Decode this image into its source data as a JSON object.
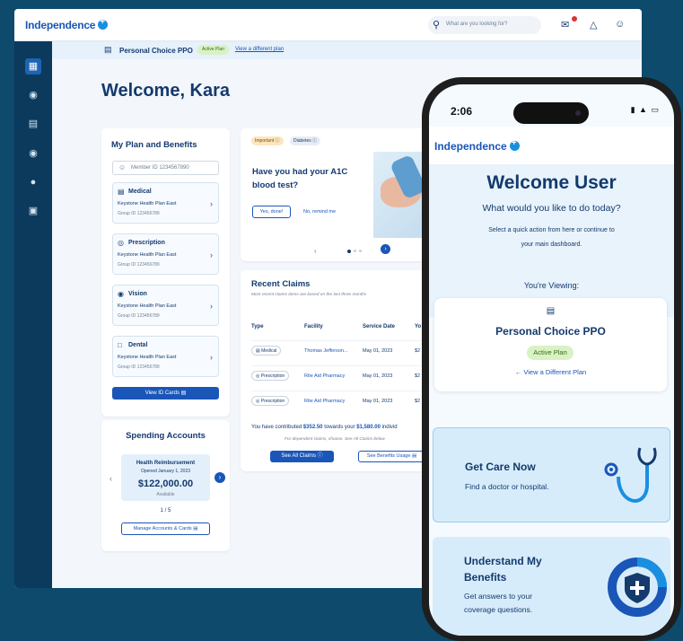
{
  "brand": {
    "name": "Independence",
    "accent": "#1a56b8",
    "navy": "#0c3a5c",
    "background": "#0d4a6b"
  },
  "desktop": {
    "search_placeholder": "What are you looking for?",
    "plan_bar": {
      "plan_name": "Personal Choice PPO",
      "status": "Active Plan",
      "link": "View a different plan"
    },
    "welcome": "Welcome, Kara",
    "plan_benefits": {
      "title": "My Plan and Benefits",
      "member_id": "Member ID 1234567890",
      "items": [
        {
          "name": "Medical",
          "plan": "Keystone Health Plan East",
          "group": "Group ID 123456789",
          "icon": "medical-icon"
        },
        {
          "name": "Prescription",
          "plan": "Keystone Health Plan East",
          "group": "Group ID 123456789",
          "icon": "pill-icon"
        },
        {
          "name": "Vision",
          "plan": "Keystone Health Plan East",
          "group": "Group ID 123456789",
          "icon": "eye-icon"
        },
        {
          "name": "Dental",
          "plan": "Keystone Health Plan East",
          "group": "Group ID 123456789",
          "icon": "tooth-icon"
        }
      ],
      "view_cards": "View ID Cards"
    },
    "reminder": {
      "chip_important": "Important",
      "chip_diabetes": "Diabetes",
      "question_1": "Have you had your A1C",
      "question_2": "blood test?",
      "btn_yes": "Yes, done!",
      "btn_remind": "No, remind me"
    },
    "claims": {
      "title": "Recent Claims",
      "subtitle": "Most recent claims items are based on the last three months",
      "headers": {
        "type": "Type",
        "facility": "Facility",
        "date": "Service Date",
        "you": "Yo"
      },
      "rows": [
        {
          "type": "Medical",
          "facility": "Thomas Jefferson...",
          "date": "May 01, 2023",
          "you": "$2"
        },
        {
          "type": "Prescription",
          "facility": "Rite Aid Pharmacy",
          "date": "May 01, 2023",
          "you": "$2"
        },
        {
          "type": "Prescription",
          "facility": "Rite Aid Pharmacy",
          "date": "May 01, 2023",
          "you": "$2"
        }
      ],
      "contrib_pre": "You have contributed ",
      "contrib_amount": "$352.50",
      "contrib_mid": " towards your ",
      "contrib_total": "$1,580.00",
      "contrib_post": " individ",
      "note": "For dependent claims, choose. See All Claims below",
      "btn_all": "See All Claims",
      "btn_usage": "See Benefits Usage"
    },
    "spending": {
      "title": "Spending Accounts",
      "account_name": "Health Reimbursement",
      "opened": "Opened January 1, 2023",
      "amount": "$122,000.00",
      "available": "Available",
      "pager": "1 / 5",
      "manage": "Manage Accounts & Cards"
    }
  },
  "phone": {
    "time": "2:06",
    "welcome": "Welcome User",
    "question": "What would you like to do today?",
    "select_line_1": "Select a quick action from here or continue to",
    "select_line_2": "your main dashboard.",
    "viewing": "You're Viewing:",
    "plan_name": "Personal Choice PPO",
    "plan_status": "Active Plan",
    "view_different": "← View a Different Plan",
    "care_title": "Get Care Now",
    "care_sub": "Find a doctor or hospital.",
    "understand_1": "Understand My",
    "understand_2": "Benefits",
    "understand_sub_1": "Get answers to your",
    "understand_sub_2": "coverage questions."
  }
}
